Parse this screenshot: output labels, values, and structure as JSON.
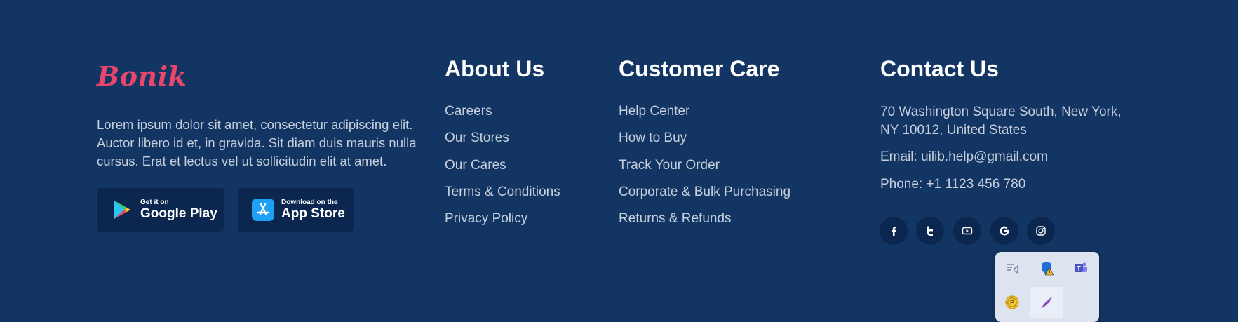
{
  "brand": {
    "name": "Bonik",
    "color": "#e8476b"
  },
  "about": {
    "description": "Lorem ipsum dolor sit amet, consectetur adipiscing elit. Auctor libero id et, in gravida. Sit diam duis mauris nulla cursus. Erat et lectus vel ut sollicitudin elit at amet."
  },
  "stores": {
    "google": {
      "small": "Get it on",
      "big": "Google Play"
    },
    "apple": {
      "small": "Download on the",
      "big": "App Store"
    }
  },
  "about_us": {
    "title": "About Us",
    "links": [
      "Careers",
      "Our Stores",
      "Our Cares",
      "Terms & Conditions",
      "Privacy Policy"
    ]
  },
  "customer_care": {
    "title": "Customer Care",
    "links": [
      "Help Center",
      "How to Buy",
      "Track Your Order",
      "Corporate & Bulk Purchasing",
      "Returns & Refunds"
    ]
  },
  "contact": {
    "title": "Contact Us",
    "address_line1": "70 Washington Square South, New York,",
    "address_line2": "NY 10012, United States",
    "email": "Email: uilib.help@gmail.com",
    "phone": "Phone: +1 1123 456 780"
  },
  "social": [
    "facebook-icon",
    "twitter-icon",
    "youtube-icon",
    "google-icon",
    "instagram-icon"
  ],
  "tray": {
    "icons": [
      "task-list-icon",
      "security-warning-icon",
      "teams-icon",
      "p-coin-icon",
      "feather-pen-icon"
    ]
  },
  "colors": {
    "background": "#133563",
    "button_bg": "#0c274f",
    "text_muted": "#c6cfdc",
    "heading": "#ffffff"
  }
}
